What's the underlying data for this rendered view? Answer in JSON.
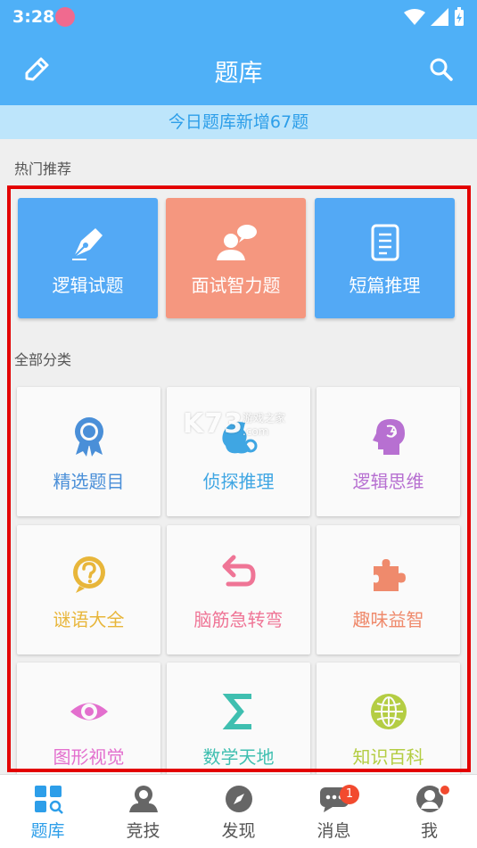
{
  "status": {
    "time": "3:28"
  },
  "header": {
    "title": "题库"
  },
  "banner": {
    "text": "今日题库新增67题"
  },
  "hot": {
    "label": "热门推荐",
    "items": [
      {
        "label": "逻辑试题",
        "icon": "pen-nib-icon",
        "color": "#53a9f5"
      },
      {
        "label": "面试智力题",
        "icon": "interview-icon",
        "color": "#f5977f"
      },
      {
        "label": "短篇推理",
        "icon": "document-icon",
        "color": "#53a9f5"
      }
    ]
  },
  "categories": {
    "label": "全部分类",
    "items": [
      {
        "label": "精选题目",
        "icon": "award-ribbon-icon",
        "color": "#4a8fd8"
      },
      {
        "label": "侦探推理",
        "icon": "detective-head-icon",
        "color": "#3fa6e3"
      },
      {
        "label": "逻辑思维",
        "icon": "brain-head-icon",
        "color": "#b770d1"
      },
      {
        "label": "谜语大全",
        "icon": "question-circle-icon",
        "color": "#e8b63a"
      },
      {
        "label": "脑筋急转弯",
        "icon": "undo-arrow-icon",
        "color": "#ef7596"
      },
      {
        "label": "趣味益智",
        "icon": "puzzle-piece-icon",
        "color": "#ef8a6c"
      },
      {
        "label": "图形视觉",
        "icon": "eye-icon",
        "color": "#e36fce"
      },
      {
        "label": "数学天地",
        "icon": "sigma-icon",
        "color": "#3fbfb0"
      },
      {
        "label": "知识百科",
        "icon": "globe-icon",
        "color": "#b4cd43"
      }
    ]
  },
  "watermark": {
    "main": "K73",
    "sub": "游戏之家",
    "sub2": ".com"
  },
  "nav": {
    "items": [
      {
        "label": "题库",
        "icon": "grid-search-icon"
      },
      {
        "label": "竞技",
        "icon": "user-group-icon"
      },
      {
        "label": "发现",
        "icon": "compass-icon"
      },
      {
        "label": "消息",
        "icon": "chat-icon"
      },
      {
        "label": "我",
        "icon": "profile-icon"
      }
    ],
    "messages_badge": "1"
  }
}
